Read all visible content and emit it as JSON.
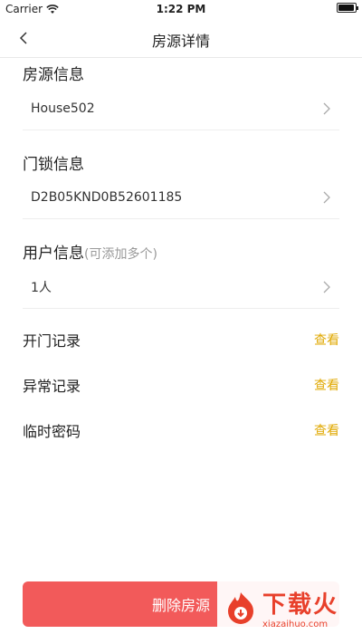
{
  "status_bar": {
    "carrier": "Carrier",
    "time": "1:22 PM"
  },
  "nav": {
    "title": "房源详情"
  },
  "sections": {
    "house": {
      "title": "房源信息",
      "value": "House502"
    },
    "lock": {
      "title": "门锁信息",
      "value": "D2B05KND0B52601185"
    },
    "user": {
      "title": "用户信息",
      "hint": "(可添加多个)",
      "value": "1人"
    }
  },
  "records": [
    {
      "label": "开门记录",
      "action": "查看"
    },
    {
      "label": "异常记录",
      "action": "查看"
    },
    {
      "label": "临时密码",
      "action": "查看"
    }
  ],
  "delete_button": {
    "label": "删除房源"
  },
  "watermark": {
    "cn": "下载火",
    "en": "xiazaihuo.com"
  },
  "colors": {
    "accent": "#e0a800",
    "danger": "#f25a5a",
    "watermark": "#e8402b"
  }
}
